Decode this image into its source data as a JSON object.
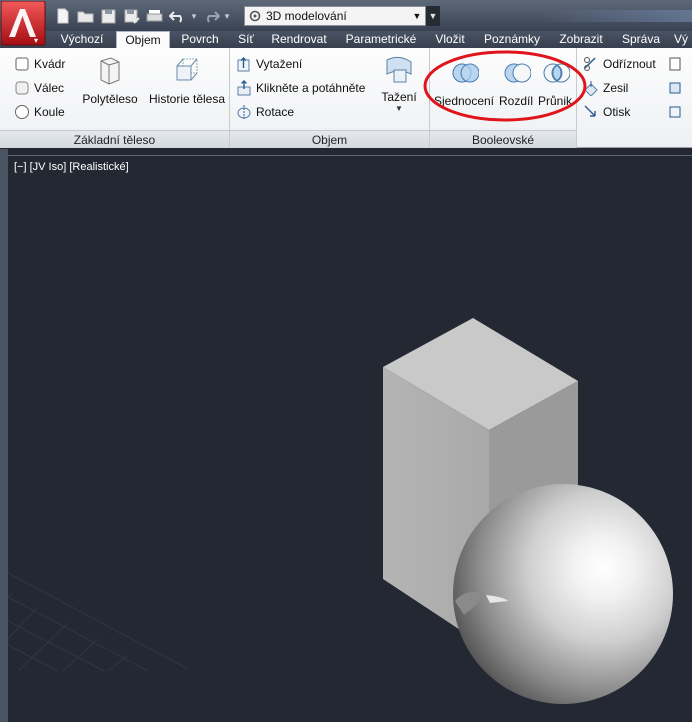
{
  "quick_access": {
    "workspace": "3D modelování"
  },
  "tabs": [
    {
      "label": "Výchozí",
      "active": false
    },
    {
      "label": "Objem",
      "active": true
    },
    {
      "label": "Povrch",
      "active": false
    },
    {
      "label": "Síť",
      "active": false
    },
    {
      "label": "Rendrovat",
      "active": false
    },
    {
      "label": "Parametrické",
      "active": false
    },
    {
      "label": "Vložit",
      "active": false
    },
    {
      "label": "Poznámky",
      "active": false
    },
    {
      "label": "Zobrazit",
      "active": false
    },
    {
      "label": "Správa",
      "active": false
    },
    {
      "label": "Vý",
      "active": false
    }
  ],
  "panels": {
    "zakladni": {
      "title": "Základní těleso",
      "kvadr": "Kvádr",
      "valec": "Válec",
      "koule": "Koule",
      "polyteleso": "Polytěleso",
      "historie": "Historie tělesa"
    },
    "objem": {
      "title": "Objem",
      "vytazeni": "Vytažení",
      "kliknete": "Klikněte a potáhněte",
      "rotace": "Rotace",
      "tazeni": "Tažení"
    },
    "booleovske": {
      "title": "Booleovské",
      "sjednoceni": "Sjednocení",
      "rozdil": "Rozdíl",
      "prunik": "Průnik"
    },
    "upravy": {
      "odriznout": "Odříznout",
      "zesil": "Zesil",
      "otisk": "Otisk"
    }
  },
  "viewport": {
    "label": "[−] [JV Iso] [Realistické]"
  },
  "colors": {
    "ribbon_bg": "#f3f5f8",
    "viewport_bg": "#232833",
    "highlight": "#e0141b",
    "acad_red": "#c8161d"
  }
}
